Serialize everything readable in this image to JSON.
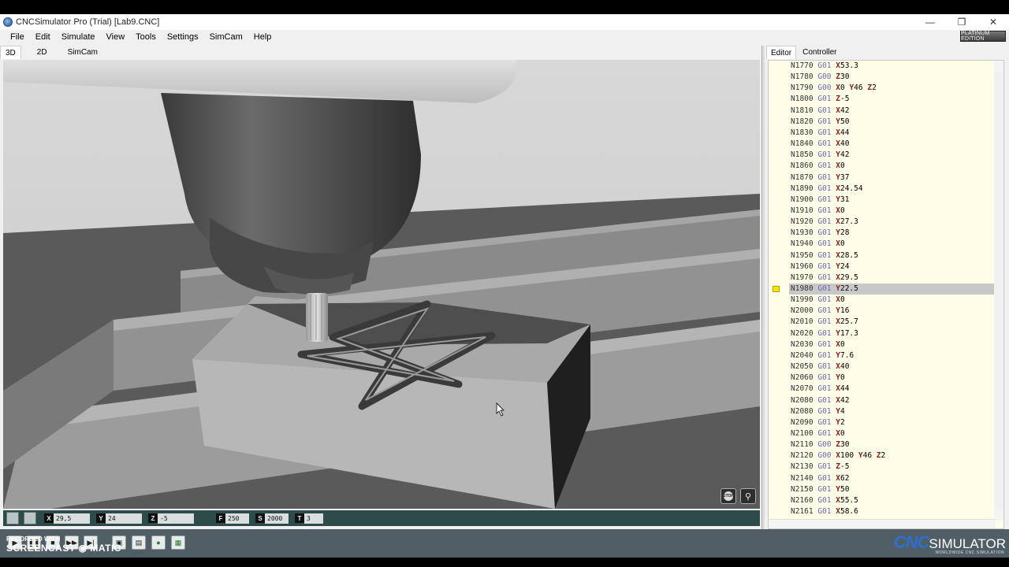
{
  "window": {
    "title": "CNCSimulator Pro (Trial) [Lab9.CNC]",
    "controls": [
      "—",
      "❐",
      "✕"
    ]
  },
  "menu": [
    "File",
    "Edit",
    "Simulate",
    "View",
    "Tools",
    "Settings",
    "SimCam",
    "Help"
  ],
  "edition_badge": "PLATINUM EDITION",
  "view_tabs": [
    "3D",
    "2D",
    "SimCam"
  ],
  "right_tabs": [
    "Editor",
    "Controller"
  ],
  "coords": {
    "x": {
      "label": "X",
      "value": "29,5"
    },
    "y": {
      "label": "Y",
      "value": "24"
    },
    "z": {
      "label": "Z",
      "value": "-5"
    },
    "f": {
      "label": "F",
      "value": "250"
    },
    "s": {
      "label": "S",
      "value": "2000"
    },
    "t": {
      "label": "T",
      "value": "3"
    }
  },
  "editor": {
    "highlighted_index": 14,
    "lines": [
      {
        "n": "N1770",
        "g": "G01",
        "args": "X53.3"
      },
      {
        "n": "N1780",
        "g": "G00",
        "args": "Z30"
      },
      {
        "n": "N1790",
        "g": "G00",
        "args": "X0 Y46 Z2"
      },
      {
        "n": "N1800",
        "g": "G01",
        "args": "Z-5"
      },
      {
        "n": "N1810",
        "g": "G01",
        "args": "X42"
      },
      {
        "n": "N1820",
        "g": "G01",
        "args": "Y50"
      },
      {
        "n": "N1830",
        "g": "G01",
        "args": "X44"
      },
      {
        "n": "N1840",
        "g": "G01",
        "args": "X40"
      },
      {
        "n": "N1850",
        "g": "G01",
        "args": "Y42"
      },
      {
        "n": "N1860",
        "g": "G01",
        "args": "X0"
      },
      {
        "n": "N1870",
        "g": "G01",
        "args": "Y37"
      },
      {
        "n": "N1890",
        "g": "G01",
        "args": "X24.54"
      },
      {
        "n": "N1900",
        "g": "G01",
        "args": "Y31"
      },
      {
        "n": "N1910",
        "g": "G01",
        "args": "X0"
      },
      {
        "n": "N1920",
        "g": "G01",
        "args": "X27.3"
      },
      {
        "n": "N1930",
        "g": "G01",
        "args": "Y28"
      },
      {
        "n": "N1940",
        "g": "G01",
        "args": "X0"
      },
      {
        "n": "N1950",
        "g": "G01",
        "args": "X28.5"
      },
      {
        "n": "N1960",
        "g": "G01",
        "args": "Y24"
      },
      {
        "n": "N1970",
        "g": "G01",
        "args": "X29.5"
      },
      {
        "n": "N1980",
        "g": "G01",
        "args": "Y22.5"
      },
      {
        "n": "N1990",
        "g": "G01",
        "args": "X0"
      },
      {
        "n": "N2000",
        "g": "G01",
        "args": "Y16"
      },
      {
        "n": "N2010",
        "g": "G01",
        "args": "X25.7"
      },
      {
        "n": "N2020",
        "g": "G01",
        "args": "Y17.3"
      },
      {
        "n": "N2030",
        "g": "G01",
        "args": "X0"
      },
      {
        "n": "N2040",
        "g": "G01",
        "args": "Y7.6"
      },
      {
        "n": "N2050",
        "g": "G01",
        "args": "X40"
      },
      {
        "n": "N2060",
        "g": "G01",
        "args": "Y0"
      },
      {
        "n": "N2070",
        "g": "G01",
        "args": "X44"
      },
      {
        "n": "N2080",
        "g": "G01",
        "args": "X42"
      },
      {
        "n": "N2080",
        "g": "G01",
        "args": "Y4"
      },
      {
        "n": "N2090",
        "g": "G01",
        "args": "Y2"
      },
      {
        "n": "N2100",
        "g": "G01",
        "args": "X0"
      },
      {
        "n": "N2110",
        "g": "G00",
        "args": "Z30"
      },
      {
        "n": "N2120",
        "g": "G00",
        "args": "X100 Y46 Z2"
      },
      {
        "n": "N2130",
        "g": "G01",
        "args": "Z-5"
      },
      {
        "n": "N2140",
        "g": "G01",
        "args": "X62"
      },
      {
        "n": "N2150",
        "g": "G01",
        "args": "Y50"
      },
      {
        "n": "N2160",
        "g": "G01",
        "args": "X55.5"
      },
      {
        "n": "N2161",
        "g": "G01",
        "args": "X58.6"
      }
    ],
    "marker_line": "N1980"
  },
  "bottom_toolbar": [
    "play",
    "pause",
    "stop",
    "fast-forward",
    "step",
    "layers",
    "film",
    "color-wheel",
    "screenshot"
  ],
  "watermark": {
    "line1": "RECORDED WITH",
    "line2": "SCREENCAST",
    "line3": "MATIC"
  },
  "brand": {
    "cnc": "CNC",
    "sim": "SIMULATOR",
    "sub": "WORLDWIDE CNC SIMULATION"
  },
  "colors": {
    "coordbar": "#2e4b4b",
    "editor_bg": "#fefde8",
    "highlight": "#c8c8c8",
    "marker": "#f3e10a",
    "brand_blue": "#2e6fd0"
  }
}
